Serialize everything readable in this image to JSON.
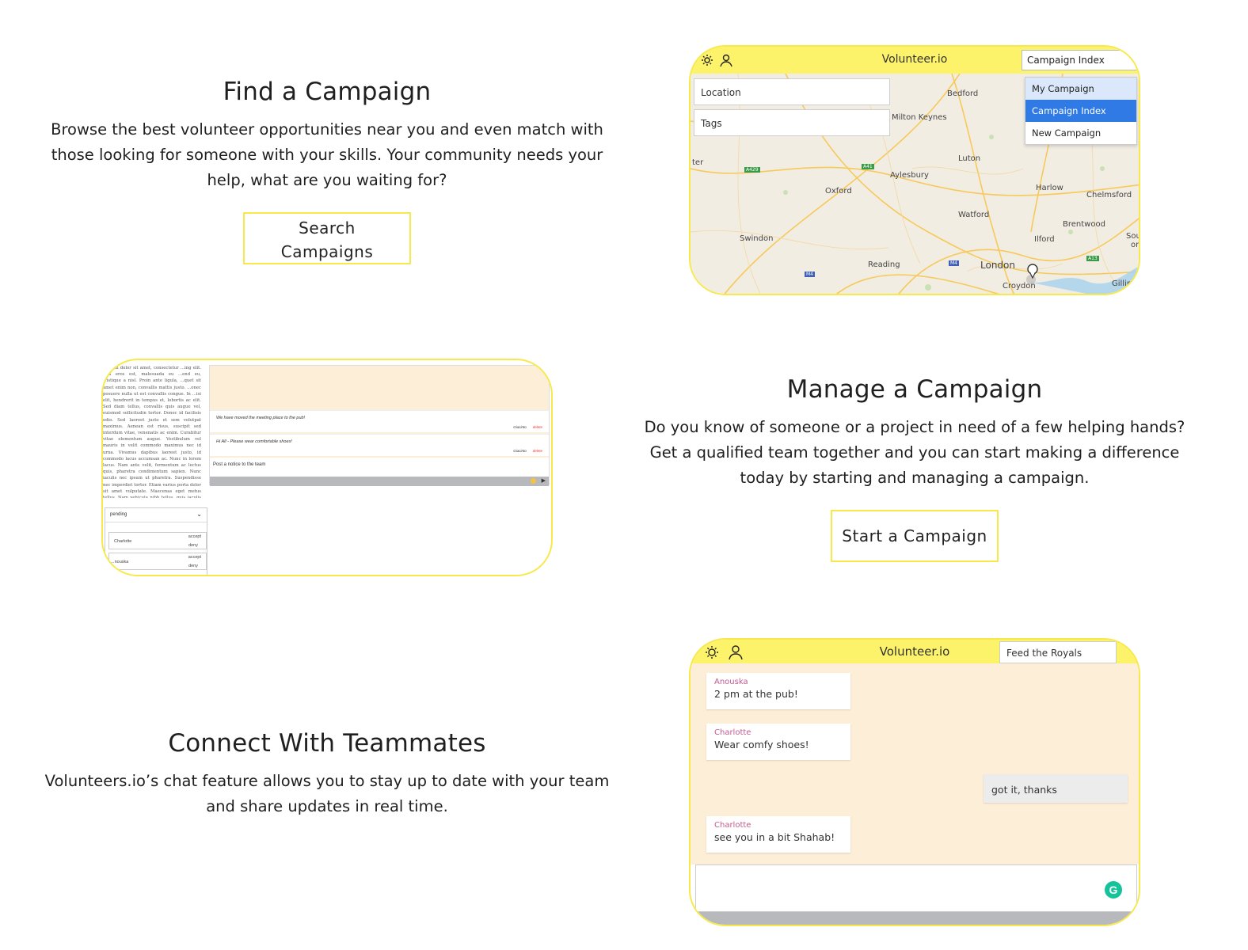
{
  "find": {
    "title": "Find a Campaign",
    "body": "Browse the best volunteer opportunities near you and even match with those looking for someone with your skills. Your community needs your help, what are you waiting for?",
    "button": "Search Campaigns"
  },
  "manage": {
    "title": "Manage a Campaign",
    "body": "Do you know of someone or a project in need of a few helping hands? Get a qualified team together and you can start making a difference today by starting and managing a campaign.",
    "button": "Start a Campaign"
  },
  "connect": {
    "title": "Connect With Teammates",
    "body": "Volunteers.io’s chat feature allows you to stay up to date with your team and share updates in real time."
  },
  "map_shot": {
    "logo": "Volunteer.io",
    "location_placeholder": "Location",
    "tags_placeholder": "Tags",
    "select_value": "Campaign Index",
    "menu": [
      "My Campaign",
      "Campaign Index",
      "New Campaign"
    ],
    "places": [
      "Bedford",
      "Milton Keynes",
      "Luton",
      "Aylesbury",
      "Oxford",
      "Harlow",
      "Chelmsford",
      "Watford",
      "Brentwood",
      "Swindon",
      "Ilford",
      "Reading",
      "London",
      "Croydon",
      "Gillingh",
      "Sout",
      "on",
      "ter"
    ],
    "roads": [
      "A429",
      "A41",
      "A13",
      "M4",
      "M4"
    ]
  },
  "dash_shot": {
    "lorem": "...psum dolor sit amet, consectetur ...ing elit. Sed eros est, malesuada eu ...end eu, tristique a nisl. Proin ante ligula, ...quet sit amet enim non, convallis mattis justo. ...onec posuere nulla ut est convallis congue. In ...isi elit, hendrerit in tempus et, lobortis ac elit. Sed diam tellus, convallis quis augue vel, euismod sollicitudin tortor. Donec id facilisis odio. Sed laoreet justo et sem volutpat maximus. Aenean est risus, suscipit sed interdum vitae, venenatis ac enim. Curabitur vitae elementum augue. Vestibulum vel mauris in velit commodo maximus nec id urna. Vivamus dapibus laoreet justo, id commodo lacus accumsan ac. Nunc in lorem lacus. Nam ante velit, fermentum ac lectus quis, pharetra condimentum sapien. Nunc iaculis nec ipsum ut pharetra. Suspendisse nec imperdiet tortor. Etiam varius porta dolor sit amet vulputate. Maecenas eget metus tellus. Nam vehicula nibh tellus, quis iaculis diam elementum ac.",
    "pending": "pending",
    "requests": [
      {
        "name": "Charlotte",
        "accept": "accept",
        "deny": "deny"
      },
      {
        "name": "...nouska",
        "accept": "accept",
        "deny": "deny"
      }
    ],
    "notices": [
      {
        "text": "We have moved the meeting place to the pub!",
        "author": "Giacinto",
        "delete": "delete"
      },
      {
        "text": "Hi All - Please wear comfortable shoes!",
        "author": "Giacinto",
        "delete": "delete"
      }
    ],
    "post_placeholder": "Post a notice to the team"
  },
  "chat_shot": {
    "logo": "Volunteer.io",
    "select_value": "Feed the Royals",
    "messages": [
      {
        "who": "Anouska",
        "msg": "2 pm at the pub!"
      },
      {
        "who": "Charlotte",
        "msg": "Wear comfy shoes!"
      },
      {
        "who": "",
        "msg": "got it, thanks"
      },
      {
        "who": "Charlotte",
        "msg": "see you in a bit Shahab!"
      }
    ]
  },
  "colors": {
    "accent_yellow": "#fdf36b",
    "border_yellow": "#f7e94b",
    "chat_bg": "#fdeed8",
    "menu_active": "#2f7ae5",
    "sender_name": "#c35b8d"
  }
}
